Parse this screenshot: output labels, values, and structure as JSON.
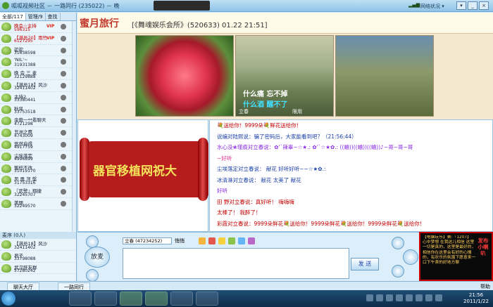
{
  "window": {
    "title": "呱呱视频社区 － 一路同行 (235022) － 晚",
    "signal": "",
    "net_status": "网络状况 ▾",
    "controls": [
      "▾",
      "_",
      "×"
    ]
  },
  "left_panel": {
    "tabs": [
      "全部/117",
      "管理/9",
      "查找"
    ],
    "users": [
      {
        "name": "晚会☆主持",
        "id": "596315",
        "vip": true,
        "badge": "VIP"
      },
      {
        "name": "【满员20】雨竹",
        "id": "6127295",
        "vip": true,
        "badge": "VIP"
      },
      {
        "name": "驼驼",
        "id": "31638598",
        "vip": false,
        "badge": ""
      },
      {
        "name": "'NIL'~",
        "id": "31931388",
        "vip": false,
        "badge": ""
      },
      {
        "name": "晚 会 三 麦",
        "id": "32129888",
        "vip": false,
        "badge": ""
      },
      {
        "name": "【满员18】风沙",
        "id": "32411402",
        "vip": false,
        "badge": ""
      },
      {
        "name": "主持2",
        "id": "33380441",
        "vip": false,
        "badge": ""
      },
      {
        "name": "秋风",
        "id": "33753518",
        "vip": false,
        "badge": ""
      },
      {
        "name": "金蓉一**看聊天",
        "id": "4721298",
        "vip": false,
        "badge": ""
      },
      {
        "name": "丑洲之鹰",
        "id": "4743009",
        "vip": false,
        "badge": ""
      },
      {
        "name": "悠然自得",
        "id": "4917759",
        "vip": false,
        "badge": ""
      },
      {
        "name": "尘埃落定",
        "id": "4996899",
        "vip": false,
        "badge": ""
      },
      {
        "name": "冤枉不改",
        "id": "31019170",
        "vip": false,
        "badge": ""
      },
      {
        "name": "凤 凰 涅 槃",
        "id": "31753316",
        "vip": false,
        "badge": ""
      },
      {
        "name": "『武警』翔捷",
        "id": "32245707",
        "vip": false,
        "badge": ""
      },
      {
        "name": "美丽",
        "id": "32249570",
        "vip": false,
        "badge": ""
      }
    ],
    "mic_section_title": "麦序 (0人)",
    "mic_users": [
      {
        "name": "【满员18】风沙",
        "id": "32411402"
      },
      {
        "name": "君子",
        "id": "33798088"
      },
      {
        "name": "武汉肝友群",
        "id": "57280242"
      }
    ]
  },
  "room": {
    "name_big": "蜜月旅行",
    "name_rest": "[《舞魂娱乐会所》(520633) 01.22 21:51]"
  },
  "videos": {
    "v2_subtitle_top": "什么痛 忘不掉",
    "v2_subtitle_bottom": "什么酒 醒不了",
    "v2_label_left": "立春",
    "v2_label_right": "限用"
  },
  "banner": {
    "text": "器官移植网祝大"
  },
  "chat": {
    "lines": [
      {
        "text": "💐送给你！9999朵💐鲜花送给你！",
        "cls": "c-red"
      },
      {
        "text": "说编对陆熙说：骗了密码后，大家能看到吧？（21:56:44）",
        "cls": "c-blue"
      },
      {
        "text": "水心没❀瑾痕对立春说：✿'`辣辜~☆★.:  ✿'`☆★✿.:  ((蛐))((蛐))((蛐))♪~哥~哥~哥",
        "cls": "c-purple"
      },
      {
        "text": "~好听",
        "cls": "c-pink"
      },
      {
        "text": "尘埃落定对立春说：                 献花                    好听好听~~☆★✿.:",
        "cls": "c-blue"
      },
      {
        "text": "冰清淋对立春说：                    献花                  太美了      献花",
        "cls": "c-blue"
      },
      {
        "text": "                好听",
        "cls": "c-purple"
      },
      {
        "text": "田 野对立春说：真好听！                                       嗨嗨嗨",
        "cls": "c-red"
      },
      {
        "text": "          太棒了！                               我醉了！",
        "cls": "c-red"
      },
      {
        "text": "彩霞对立春说：9999朵鲜花💐送给你！9999朵鲜花💐送给你！9999朵鲜花💐送给你！",
        "cls": "c-red"
      },
      {
        "text": "💐送给你！9999朵💐鲜花送给你！",
        "cls": "c-red"
      }
    ]
  },
  "input": {
    "speak_label": "放麦",
    "target": "立春 (47234252)",
    "private_label": "悄悄",
    "send_label": "发 送"
  },
  "ad": {
    "body": "【电脑玩乐】赛:『1207】 心中梦想 在我这儿相信 这里一切是真的，这里是最好的，相信你在这里会有好的心情的，有欢乐的氛围下愿意来一口下午茶的好地方聊",
    "side": "发布小喇叭"
  },
  "bottom_tabs": [
    "聊天大厅",
    "一路同行"
  ],
  "help_label": "帮助",
  "taskbar": {
    "time": "21:56",
    "date": "2011/1/22"
  }
}
